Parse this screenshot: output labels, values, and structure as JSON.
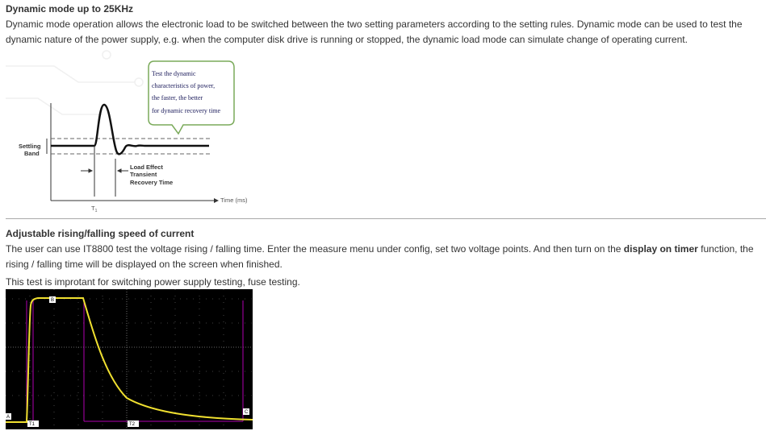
{
  "section1": {
    "title": "Dynamic mode up to 25KHz",
    "body": "Dynamic mode operation allows the electronic load to be switched between the two setting parameters according to the setting rules. Dynamic mode can be used to test the dynamic nature of the power supply, e.g. when the computer disk drive is running or stopped, the dynamic load mode can simulate change of operating current."
  },
  "figure1": {
    "callout": [
      "Test the dynamic",
      "characteristics of power,",
      "the faster, the better",
      "for dynamic recovery time"
    ],
    "settling_band": [
      "Settling",
      "Band"
    ],
    "load_effect": [
      "Load Effect",
      "Transient",
      "Recovery Time"
    ],
    "t1": "T",
    "t1_sub": "1",
    "xaxis": "Time (ms)"
  },
  "section2": {
    "title": "Adjustable rising/falling speed of current",
    "body_before": "The user can use IT8800 test the voltage rising / falling time. Enter the measure menu under config, set two voltage points. And then turn on the ",
    "body_bold": "display on timer",
    "body_after": " function, the rising / falling time will be displayed on the screen when finished.",
    "body2": "This test is improtant for switching power supply testing, fuse testing."
  },
  "figure2": {
    "marker_a": "A",
    "marker_b": "B",
    "marker_c": "C",
    "t1_label": "T1",
    "t2_label": "T2",
    "colors": {
      "background": "#000000",
      "trace": "#f0e030",
      "markers": "#b000b0"
    }
  }
}
